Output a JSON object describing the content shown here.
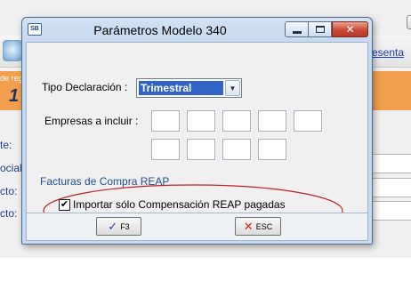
{
  "background": {
    "link_text": "resenta",
    "orange_small_text": "de reg",
    "orange_big_text": "1",
    "labels": [
      "te:",
      "ocial",
      "cto:",
      "cto:"
    ]
  },
  "dialog": {
    "app_icon_text": "SB",
    "title": "Parámetros Modelo 340",
    "tipo_declaracion": {
      "label": "Tipo Declaración :",
      "selected": "Trimestral"
    },
    "empresas": {
      "label": "Empresas a incluir :"
    },
    "section_title": "Facturas de Compra REAP",
    "checkbox": {
      "label": "Importar sólo Compensación REAP pagadas",
      "checked": true,
      "mark": "✔"
    },
    "buttons": {
      "f3_label": "F3",
      "esc_label": "ESC"
    }
  },
  "colors": {
    "accent_orange": "#f3a04e",
    "selection_blue": "#3164c6",
    "section_blue": "#214e94",
    "annotation_red": "#c22026"
  }
}
